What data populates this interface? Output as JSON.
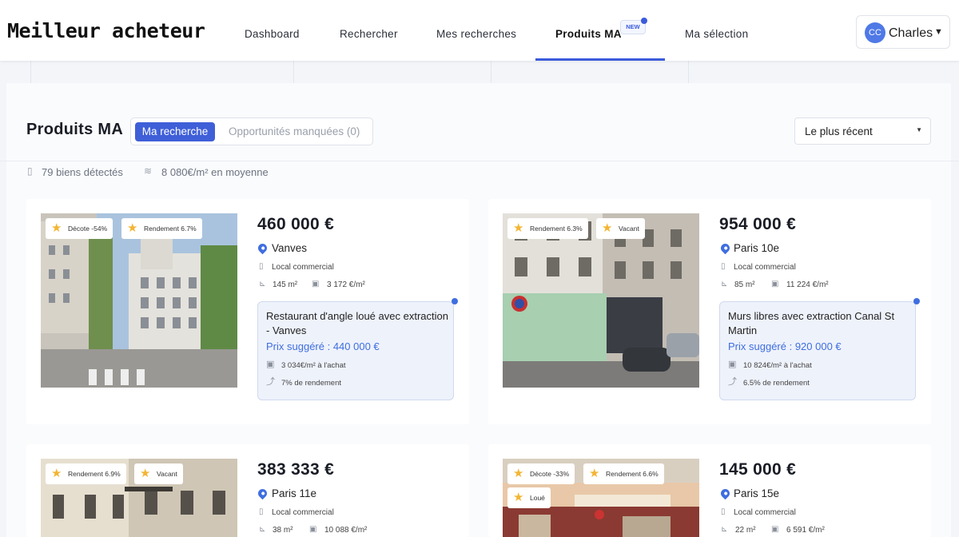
{
  "app": {
    "logo": "Meilleur acheteur"
  },
  "nav": {
    "items": [
      "Dashboard",
      "Rechercher",
      "Mes recherches",
      "Produits MA",
      "Ma sélection"
    ],
    "active": "Produits MA",
    "new_badge": "NEW"
  },
  "user": {
    "initials": "CC",
    "name": "Charles"
  },
  "page": {
    "title": "Produits MA",
    "tabs": [
      "Ma recherche",
      "Opportunités manquées (0)"
    ],
    "sort": "Le plus récent",
    "stats": {
      "count": "79 biens détectés",
      "average": "8 080€/m² en moyenne"
    }
  },
  "colors": {
    "accent": "#3f5fd8",
    "star": "#f2b533",
    "info_bg": "#eef2fb"
  },
  "listings": [
    {
      "tags": [
        "Décote -54%",
        "Rendement 6.7%"
      ],
      "price": "460 000 €",
      "city": "Vanves",
      "type": "Local commercial",
      "surface": "145 m²",
      "price_m2": "3 172 €/m²",
      "box_title": "Restaurant d'angle loué avec extraction - Vanves",
      "suggested": "Prix suggéré : 440 000 €",
      "buy_m2": "3 034€/m² à l'achat",
      "yield": "7% de rendement"
    },
    {
      "tags": [
        "Rendement 6.3%",
        "Vacant"
      ],
      "price": "954 000 €",
      "city": "Paris 10e",
      "type": "Local commercial",
      "surface": "85 m²",
      "price_m2": "11 224 €/m²",
      "box_title": "Murs libres avec extraction Canal St Martin",
      "suggested": "Prix suggéré : 920 000 €",
      "buy_m2": "10 824€/m² à l'achat",
      "yield": "6.5% de rendement"
    },
    {
      "tags": [
        "Rendement 6.9%",
        "Vacant"
      ],
      "price": "383 333 €",
      "city": "Paris 11e",
      "type": "Local commercial",
      "surface": "38 m²",
      "price_m2": "10 088 €/m²"
    },
    {
      "tags": [
        "Décote -33%",
        "Rendement 6.6%",
        "Loué"
      ],
      "price": "145 000 €",
      "city": "Paris 15e",
      "type": "Local commercial",
      "surface": "22 m²",
      "price_m2": "6 591 €/m²"
    }
  ]
}
